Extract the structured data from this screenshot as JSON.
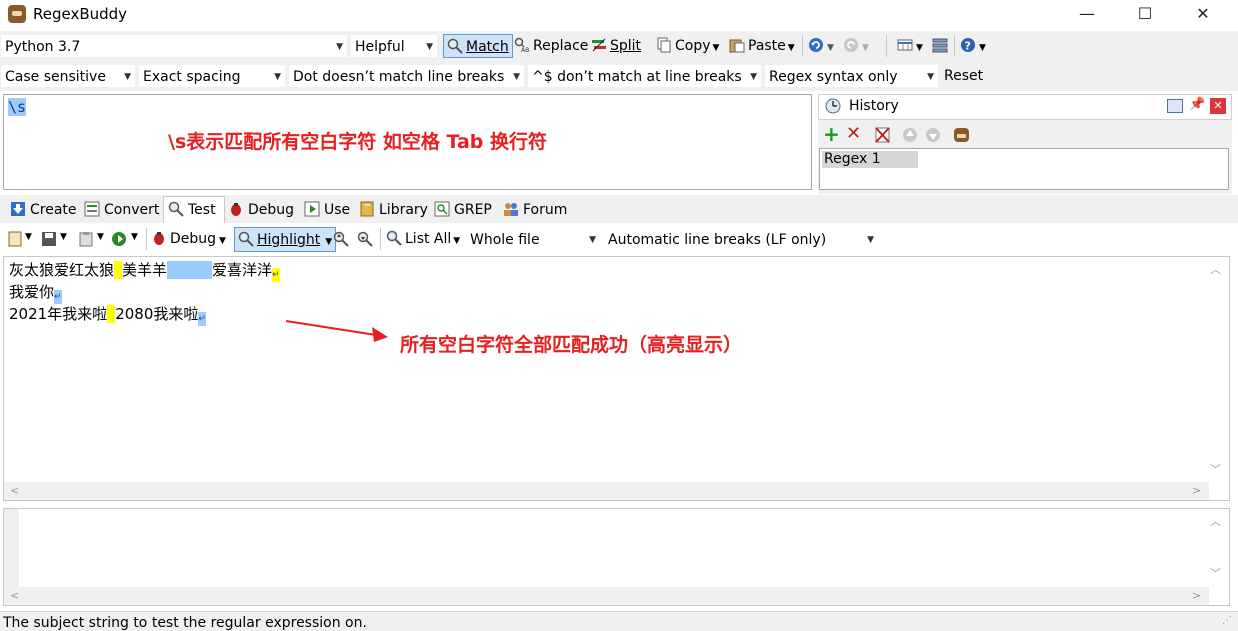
{
  "window": {
    "title": "RegexBuddy",
    "minimize": "—",
    "maximize": "☐",
    "close": "✕"
  },
  "toolbar1": {
    "flavor": "Python 3.7",
    "helpful": "Helpful",
    "match": "Match",
    "replace": "Replace",
    "split": "Split",
    "copy": "Copy",
    "paste": "Paste"
  },
  "toolbar2": {
    "case": "Case sensitive",
    "spacing": "Exact spacing",
    "dot": "Dot doesn’t match line breaks",
    "anchors": "^$ don’t match at line breaks",
    "syntax": "Regex syntax only",
    "reset": "Reset"
  },
  "regex": {
    "text": "\\s",
    "annotation": "\\s表示匹配所有空白字符 如空格 Tab 换行符"
  },
  "history": {
    "title": "History",
    "items": [
      "Regex 1"
    ]
  },
  "tabs": [
    "Create",
    "Convert",
    "Test",
    "Debug",
    "Use",
    "Library",
    "GREP",
    "Forum"
  ],
  "test_toolbar": {
    "debug": "Debug",
    "highlight": "Highlight",
    "list_all": "List All",
    "scope": "Whole file",
    "line_breaks": "Automatic line breaks (LF only)"
  },
  "subject": {
    "line1_a": "灰太狼爱红太狼",
    "line1_b": "美羊羊",
    "line1_c": "爱喜洋洋",
    "line2": "我爱你",
    "line3_a": "2021年我来啦",
    "line3_b": "2080我来啦",
    "annotation": "所有空白字符全部匹配成功（高亮显示）"
  },
  "status": {
    "text": "The subject string to test the regular expression on."
  },
  "colors": {
    "annotation": "#e62020",
    "highlight_yellow": "#ffff00",
    "highlight_blue": "#99ccff"
  }
}
